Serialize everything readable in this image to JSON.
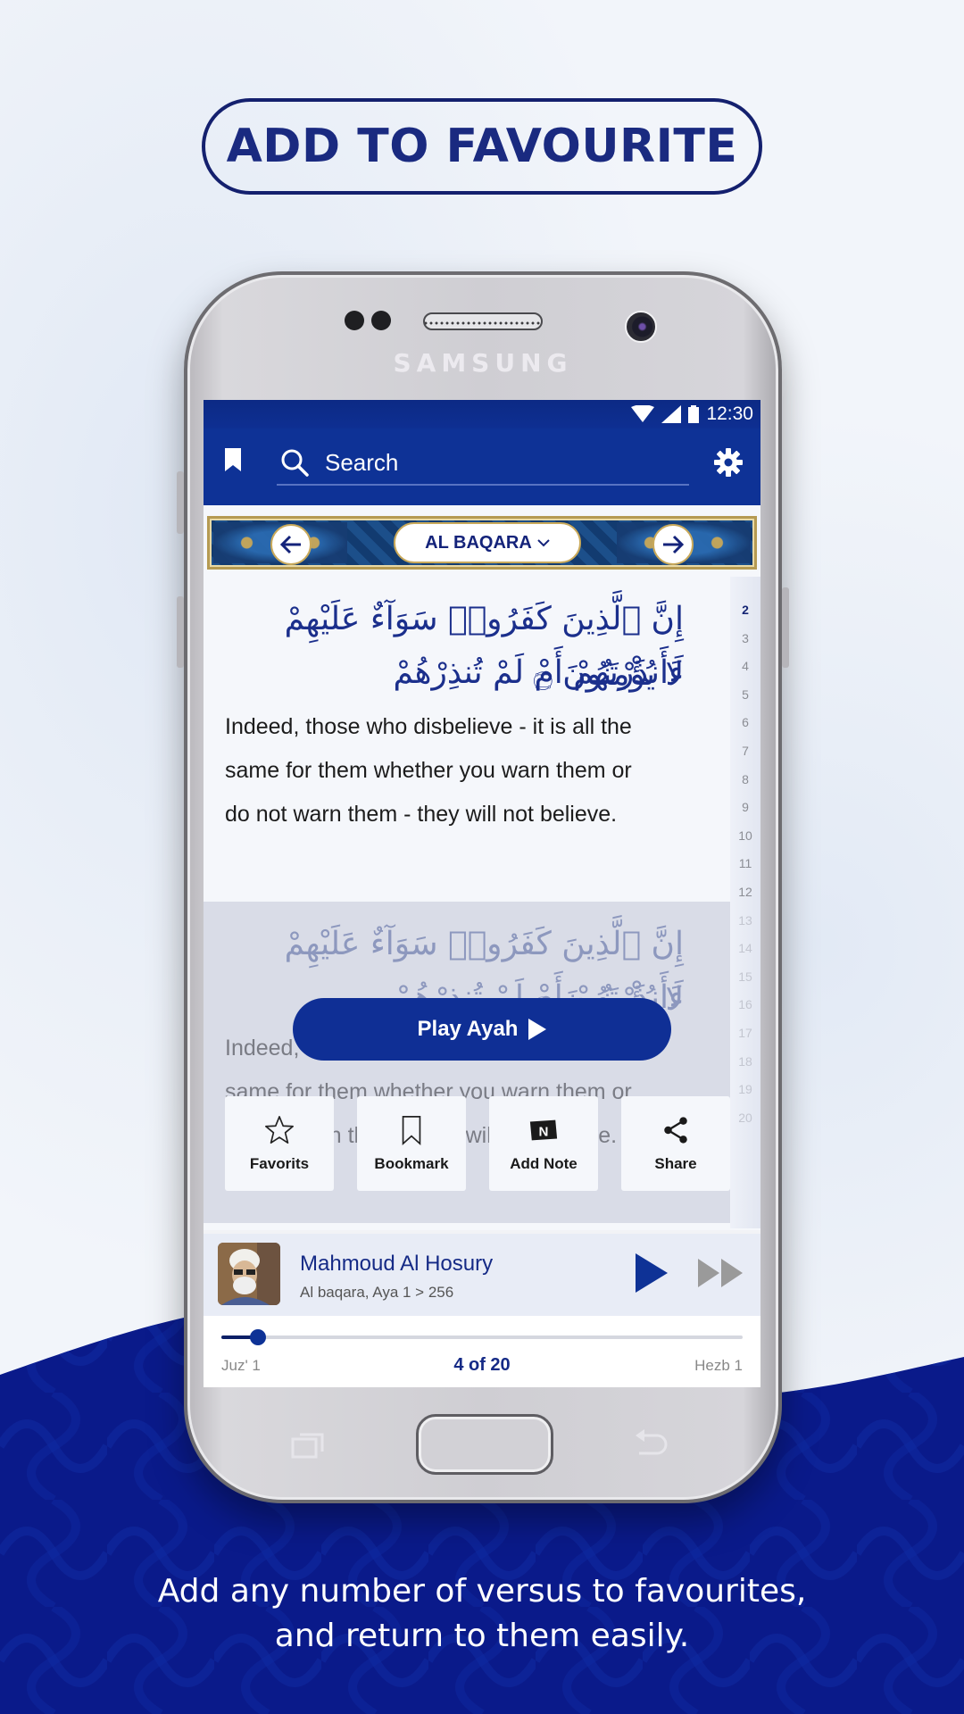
{
  "promo": {
    "headline": "ADD TO FAVOURITE",
    "caption_line1": "Add any number of versus to favourites,",
    "caption_line2": "and return to them easily."
  },
  "device": {
    "brand": "SAMSUNG"
  },
  "status_bar": {
    "time": "12:30",
    "icons": [
      "wifi-icon",
      "signal-icon",
      "battery-icon"
    ]
  },
  "app_bar": {
    "search_placeholder": "Search",
    "left_icon": "bookmark-icon",
    "right_icon": "gear-icon"
  },
  "surah_nav": {
    "prev_icon": "arrow-left-icon",
    "name": "AL BAQARA",
    "dropdown_icon": "chevron-down-icon",
    "next_icon": "arrow-right-icon"
  },
  "verse": {
    "arabic_line1": "إِنَّ ٱلَّذِينَ كَفَرُوا۟ سَوَآءٌ عَلَيْهِمْ ءَأَنذَرْتَهُمْ أَمْ لَمْ تُنذِرْهُمْ",
    "arabic_line2": "لَا يُؤْمِنُونَ ۝",
    "translation_line1": "Indeed, those who disbelieve - it is all the",
    "translation_line2": "same for them whether you warn them or",
    "translation_line3": "do not warn them - they will not believe."
  },
  "ayah_index": {
    "active": "2",
    "numbers": [
      "2",
      "3",
      "4",
      "5",
      "6",
      "7",
      "8",
      "9",
      "10",
      "11",
      "12",
      "13",
      "14",
      "15",
      "16",
      "17",
      "18",
      "19",
      "20"
    ]
  },
  "context_menu": {
    "play_ayah_label": "Play Ayah",
    "actions": [
      {
        "label": "Favorits",
        "icon": "star-icon"
      },
      {
        "label": "Bookmark",
        "icon": "bookmark-outline-icon"
      },
      {
        "label": "Add Note",
        "icon": "note-icon",
        "glyph": "N"
      },
      {
        "label": "Share",
        "icon": "share-icon"
      }
    ]
  },
  "player": {
    "reciter": "Mahmoud Al Hosury",
    "subtitle": "Al baqara, Aya 1 > 256",
    "play_icon": "play-icon",
    "next_icon": "fast-forward-icon"
  },
  "progress": {
    "left_label": "Juz' 1",
    "center_label": "4 of 20",
    "right_label": "Hezb 1",
    "fraction": 0.07
  },
  "colors": {
    "primary": "#0e3296",
    "headline": "#1a2a80",
    "wave": "#0a1a8a",
    "arabic": "#1b2f8c"
  }
}
